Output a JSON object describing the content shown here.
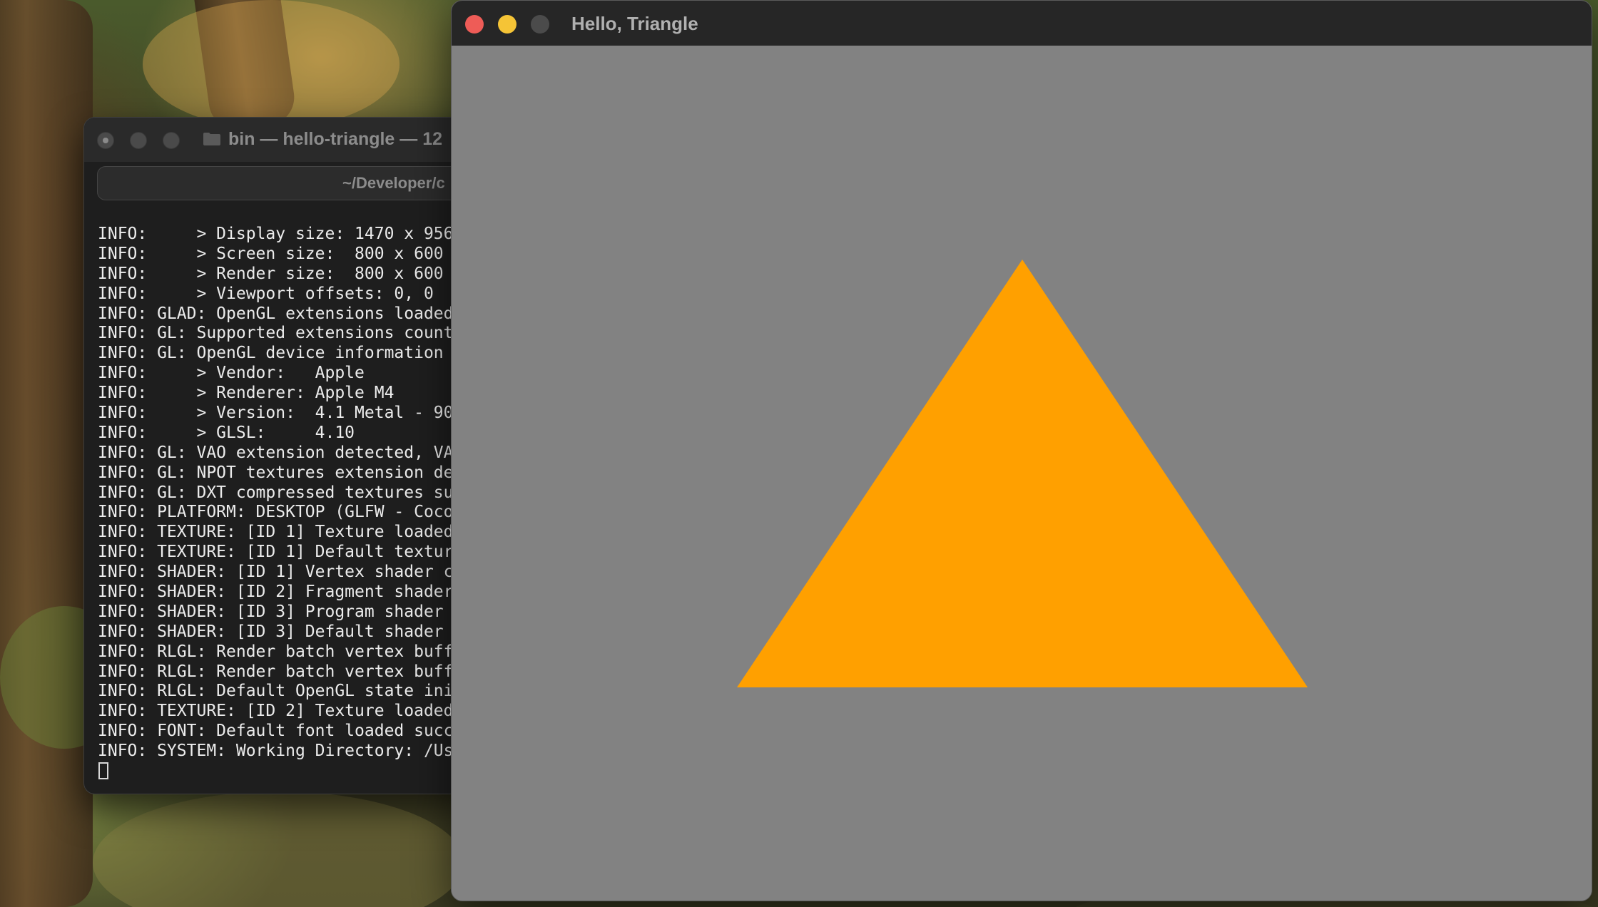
{
  "colors": {
    "gl_clear": "#828282",
    "triangle": "#ffa000",
    "close_red": "#ee5c57",
    "minimize_yellow": "#f5c436",
    "terminal_bg": "#1e1e1e",
    "terminal_text": "#ececec"
  },
  "terminal": {
    "title": "bin — hello-triangle — 12",
    "path": "~/Developer/c",
    "lines": [
      "INFO:     > Display size: 1470 x 956",
      "INFO:     > Screen size:  800 x 600",
      "INFO:     > Render size:  800 x 600",
      "INFO:     > Viewport offsets: 0, 0",
      "INFO: GLAD: OpenGL extensions loaded",
      "INFO: GL: Supported extensions count",
      "INFO: GL: OpenGL device information",
      "INFO:     > Vendor:   Apple",
      "INFO:     > Renderer: Apple M4",
      "INFO:     > Version:  4.1 Metal - 90",
      "INFO:     > GLSL:     4.10",
      "INFO: GL: VAO extension detected, VA",
      "INFO: GL: NPOT textures extension de",
      "INFO: GL: DXT compressed textures su",
      "INFO: PLATFORM: DESKTOP (GLFW - Coco",
      "INFO: TEXTURE: [ID 1] Texture loaded",
      "INFO: TEXTURE: [ID 1] Default textur",
      "INFO: SHADER: [ID 1] Vertex shader c",
      "INFO: SHADER: [ID 2] Fragment shader",
      "INFO: SHADER: [ID 3] Program shader",
      "INFO: SHADER: [ID 3] Default shader",
      "INFO: RLGL: Render batch vertex buff",
      "INFO: RLGL: Render batch vertex buff",
      "INFO: RLGL: Default OpenGL state ini",
      "INFO: TEXTURE: [ID 2] Texture loaded",
      "INFO: FONT: Default font loaded succ",
      "INFO: SYSTEM: Working Directory: /Us"
    ]
  },
  "gl_window": {
    "title": "Hello, Triangle",
    "triangle_vertices": [
      [
        0,
        0.5
      ],
      [
        -0.5,
        -0.5
      ],
      [
        0.5,
        -0.5
      ]
    ]
  }
}
